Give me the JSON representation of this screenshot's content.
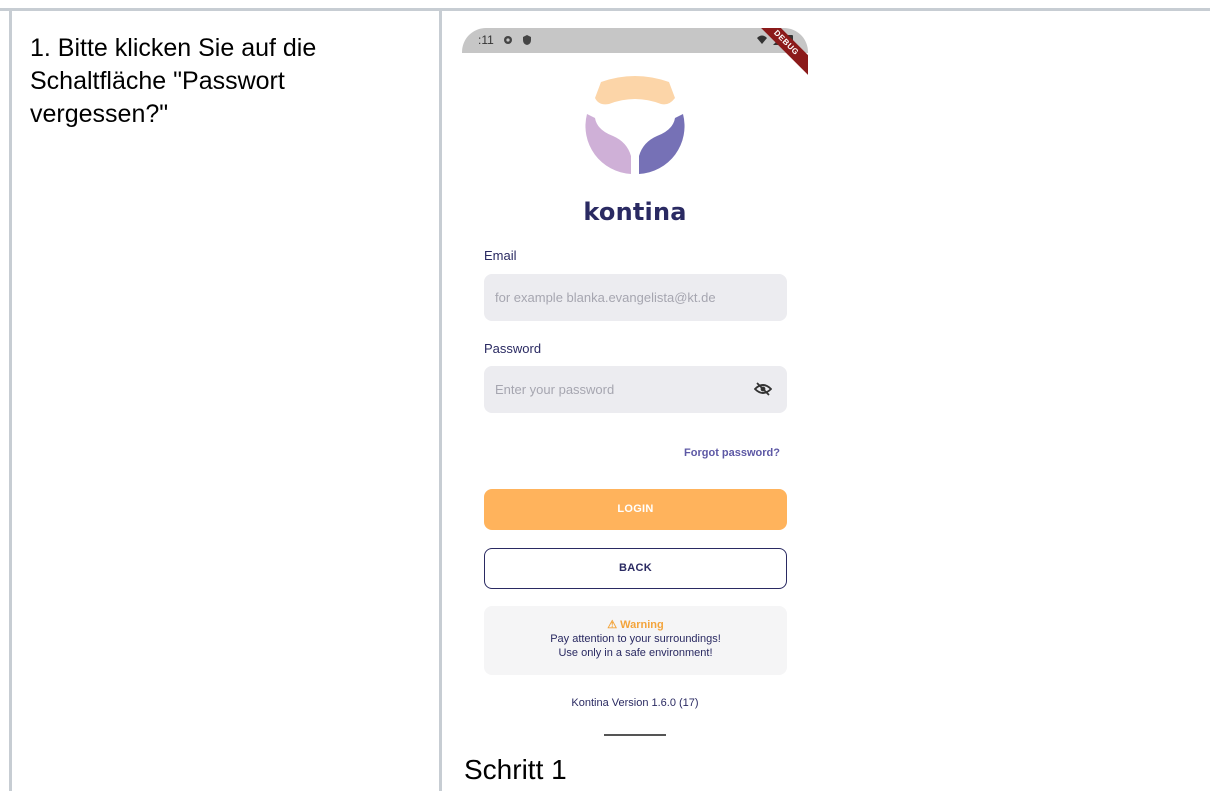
{
  "document": {
    "instruction": "1. Bitte klicken Sie auf die Schaltfläche \"Passwort vergessen?\"",
    "step_label": "Schritt 1"
  },
  "statusbar": {
    "time": ":11",
    "left_icons": "gear-icon, shield-icon",
    "right_icons": "wifi-icon, signal-icon, battery-icon",
    "debug_badge": "DEBUG"
  },
  "app": {
    "brand_name": "kontina",
    "email_label": "Email",
    "email_placeholder": "for example blanka.evangelista@kt.de",
    "email_value": "",
    "password_label": "Password",
    "password_placeholder": "Enter your password",
    "password_value": "",
    "forgot_password": "Forgot password?",
    "login_button": "LOGIN",
    "back_button": "BACK",
    "warning": {
      "title": "⚠ Warning",
      "line1": "Pay attention to your surroundings!",
      "line2": "Use only in a safe environment!"
    },
    "version": "Kontina Version 1.6.0 (17)"
  },
  "colors": {
    "brand_navy": "#2a2a62",
    "login_orange": "#ffb35c",
    "warning_orange": "#f3a43b",
    "link_purple": "#5d58a5",
    "logo_peach": "#fcd5a8",
    "logo_lilac": "#cfb0d7",
    "logo_indigo": "#7671b6"
  }
}
